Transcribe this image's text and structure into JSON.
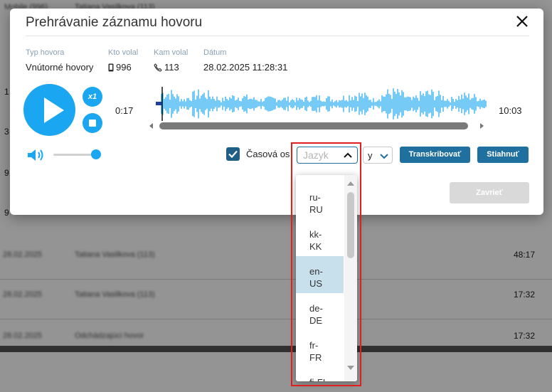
{
  "background": {
    "header_cells": [
      "Mobile (996)",
      "Tatiana Vasilkova (113)"
    ],
    "rows": [
      {
        "blur_a": "28.02.2025",
        "blur_b": "Tatiana Vasilkova (113)",
        "duration": "48:17"
      },
      {
        "blur_a": "28.02.2025",
        "blur_b": "Tatiana Vasilkova (113)",
        "duration": "17:32"
      },
      {
        "blur_a": "28.02.2025",
        "blur_b": "Odchádzajúci hovor",
        "duration": "17:32"
      }
    ],
    "edge_chars": [
      "1",
      "3",
      "9",
      "9"
    ]
  },
  "dialog": {
    "title": "Prehrávanie záznamu hovoru",
    "meta": {
      "type_label": "Typ hovora",
      "type_value": "Vnútorné hovory",
      "caller_label": "Kto volal",
      "caller_value": "996",
      "callee_label": "Kam volal",
      "callee_value": "113",
      "date_label": "Dátum",
      "date_value": "28.02.2025 11:28:31"
    },
    "player": {
      "speed": "x1",
      "current_time": "0:17",
      "total_time": "10:03",
      "volume": 1.0
    },
    "controls": {
      "timeline_label": "Časová os",
      "language_placeholder": "Jazyk",
      "small_select_value": "y",
      "transcribe_label": "Transkribovať",
      "download_label": "Stiahnuť",
      "close_label": "Zavrieť"
    }
  },
  "language_dropdown": {
    "options": [
      {
        "line1": "ru-",
        "line2": "RU"
      },
      {
        "line1": "kk-",
        "line2": "KK"
      },
      {
        "line1": "en-",
        "line2": "US"
      },
      {
        "line1": "de-",
        "line2": "DE"
      },
      {
        "line1": "fr-",
        "line2": "FR"
      },
      {
        "line1": "fi-FI",
        "line2": ""
      }
    ],
    "selected_index": 2
  },
  "colors": {
    "accent": "#1aa6f0",
    "primary_button": "#1f6f9f",
    "highlight_border": "#e02020"
  }
}
